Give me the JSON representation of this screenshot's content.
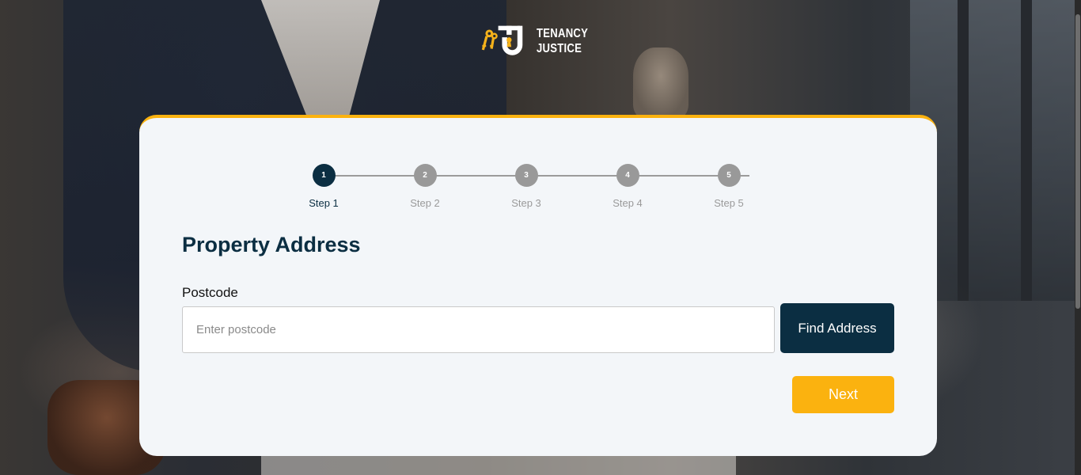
{
  "brand": {
    "line1": "TENANCY",
    "line2": "JUSTICE"
  },
  "colors": {
    "primary": "#0b2e42",
    "accent": "#fbb20f",
    "inactive_step": "#999999",
    "card_bg": "#f3f6f9"
  },
  "stepper": {
    "current": 1,
    "steps": [
      {
        "number": "1",
        "label": "Step 1"
      },
      {
        "number": "2",
        "label": "Step 2"
      },
      {
        "number": "3",
        "label": "Step 3"
      },
      {
        "number": "4",
        "label": "Step 4"
      },
      {
        "number": "5",
        "label": "Step 5"
      }
    ]
  },
  "form": {
    "title": "Property Address",
    "postcode": {
      "label": "Postcode",
      "value": "",
      "placeholder": "Enter postcode"
    },
    "find_button": "Find Address",
    "next_button": "Next"
  },
  "icons": {
    "logo": "keys-lock-logo-icon"
  }
}
